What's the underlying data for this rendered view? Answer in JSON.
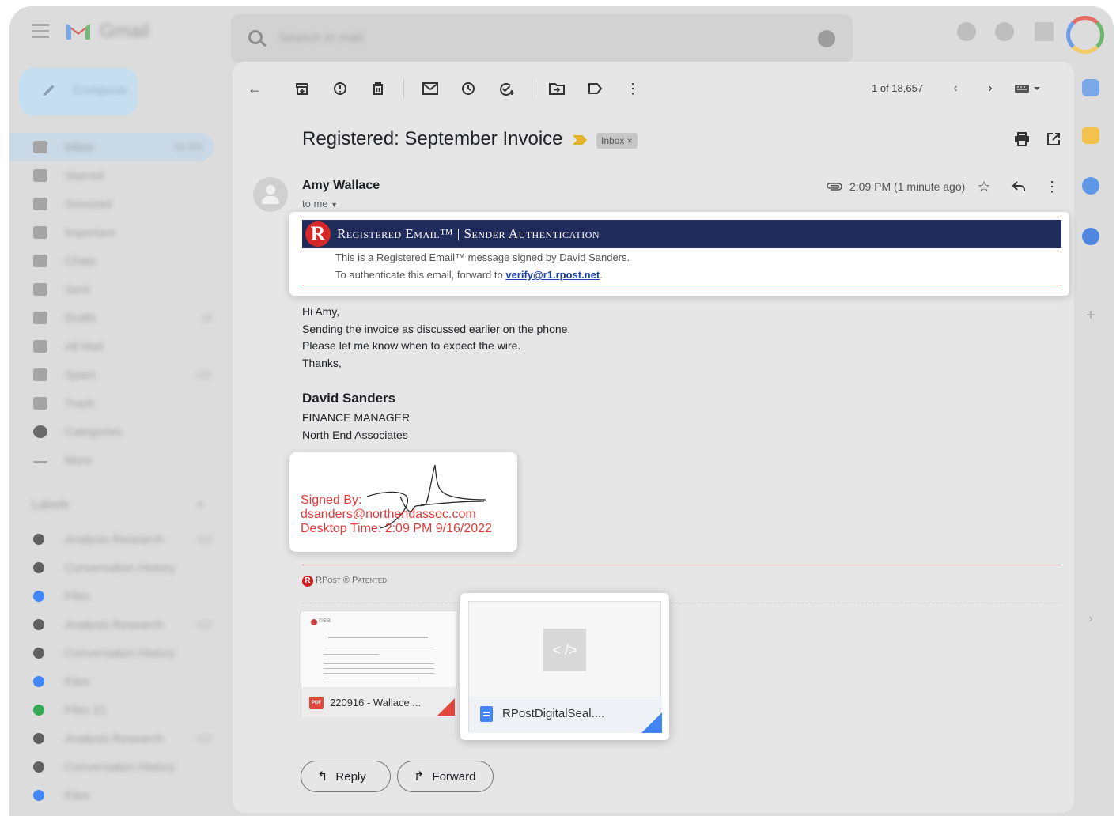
{
  "app": {
    "name": "Gmail"
  },
  "search": {
    "placeholder": "Search in mail"
  },
  "sidebar": {
    "compose_label": "Compose",
    "items": [
      {
        "label": "Inbox",
        "count": "18,456"
      },
      {
        "label": "Starred",
        "count": ""
      },
      {
        "label": "Snoozed",
        "count": ""
      },
      {
        "label": "Important",
        "count": ""
      },
      {
        "label": "Chats",
        "count": ""
      },
      {
        "label": "Sent",
        "count": ""
      },
      {
        "label": "Drafts",
        "count": "16"
      },
      {
        "label": "All Mail",
        "count": ""
      },
      {
        "label": "Spam",
        "count": "121"
      },
      {
        "label": "Trash",
        "count": ""
      },
      {
        "label": "Categories",
        "count": ""
      },
      {
        "label": "More",
        "count": ""
      }
    ],
    "labels_heading": "Labels",
    "labels": [
      {
        "label": "Analysis Research",
        "count": "112",
        "color": "#5f5f5f"
      },
      {
        "label": "Conversation History",
        "count": "",
        "color": "#5f5f5f"
      },
      {
        "label": "Files",
        "count": "",
        "color": "#4285f4"
      },
      {
        "label": "Analysis Research",
        "count": "112",
        "color": "#5f5f5f"
      },
      {
        "label": "Conversation History",
        "count": "",
        "color": "#5f5f5f"
      },
      {
        "label": "Files",
        "count": "",
        "color": "#4285f4"
      },
      {
        "label": "Files 21",
        "count": "",
        "color": "#34a853"
      },
      {
        "label": "Analysis Research",
        "count": "112",
        "color": "#5f5f5f"
      },
      {
        "label": "Conversation History",
        "count": "",
        "color": "#5f5f5f"
      },
      {
        "label": "Files",
        "count": "",
        "color": "#4285f4"
      }
    ]
  },
  "toolbar": {
    "pager": "1 of 18,657"
  },
  "email": {
    "subject": "Registered: September Invoice",
    "label_badge": "Inbox ×",
    "sender": "Amy Wallace",
    "to_line": "to me",
    "time": "2:09 PM (1 minute ago)",
    "registered": {
      "logo": "R",
      "title": "Registered Email™ | Sender Authentication",
      "line1": "This is a Registered Email™ message signed by David Sanders.",
      "line2_prefix": "To authenticate this email, forward to ",
      "line2_link": "verify@r1.rpost.net",
      "line2_suffix": "."
    },
    "body": [
      "Hi Amy,",
      "Sending the invoice as discussed earlier on the phone.",
      "Please let me know when to expect the wire.",
      "Thanks,"
    ],
    "signature": {
      "name": "David Sanders",
      "title": "FINANCE MANAGER",
      "company": "North End Associates"
    },
    "signed_card": {
      "line1": "Signed By:",
      "line2": "dsanders@northendassoc.com",
      "line3": "Desktop Time: 2:09 PM 9/16/2022"
    },
    "patent": {
      "logo": "R",
      "text": "RPost ® Patented"
    },
    "attachments": [
      {
        "name": "220916 - Wallace ...",
        "type": "pdf",
        "icon_text": "PDF",
        "thumb_brand": "nea"
      },
      {
        "name": "RPostDigitalSeal....",
        "type": "html",
        "icon_text": "< />"
      }
    ],
    "reply_label": "Reply",
    "forward_label": "Forward"
  },
  "colors": {
    "registered_bar": "#1f2b5b",
    "signature_red": "#e03a3a",
    "link_blue": "#1a3fb0"
  }
}
